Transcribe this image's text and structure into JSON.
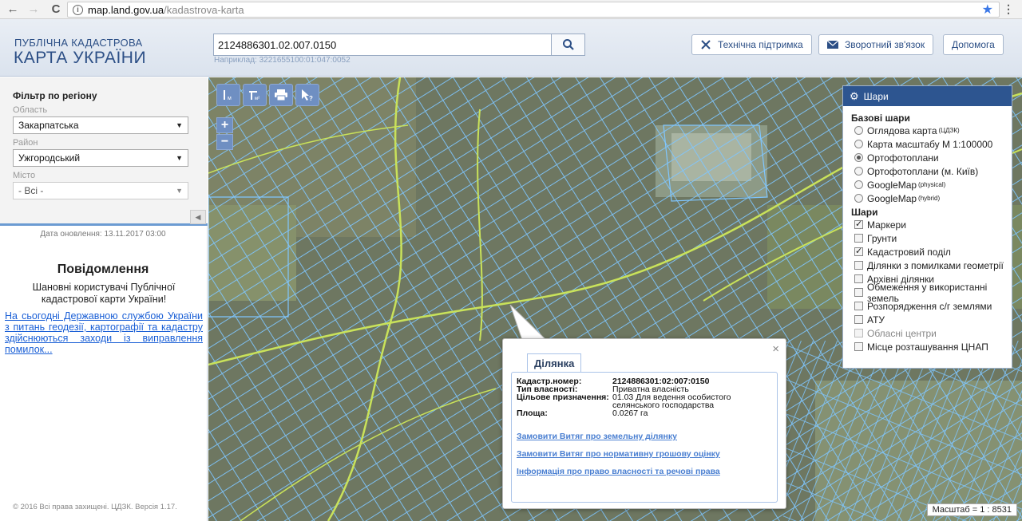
{
  "browser": {
    "back": "←",
    "forward": "→",
    "reload": "C",
    "url_host": "map.land.gov.ua",
    "url_path": "/kadastrova-karta",
    "star": "★",
    "menu": "⋮"
  },
  "header": {
    "logo_top": "ПУБЛІЧНА КАДАСТРОВА",
    "logo_bottom": "КАРТА УКРАЇНИ",
    "search_value": "2124886301.02.007.0150",
    "search_hint": "Наприклад: 3221655100:01:047:0052",
    "buttons": {
      "support": "Технічна підтримка",
      "feedback": "Зворотний зв'язок",
      "help": "Допомога"
    }
  },
  "sidebar": {
    "filter_title": "Фільтр по регіону",
    "region_label": "Область",
    "region_value": "Закарпатська",
    "district_label": "Район",
    "district_value": "Ужгородський",
    "city_label": "Місто",
    "city_value": "- Всі -",
    "update_date": "Дата оновлення: 13.11.2017 03:00",
    "message_title": "Повідомлення",
    "message_body": "Шановні користувачі Публічної кадастрової карти України!",
    "message_link": "На сьогодні Державною службою України з питань геодезії, картографії та кадастру здійснюються заходи із виправлення помилок...",
    "copyright": "© 2016 Всі права захищені. ЦДЗК. Версія 1.17."
  },
  "map": {
    "tools": [
      "I м",
      "I мг",
      "print",
      "info"
    ],
    "zoom_in": "+",
    "zoom_out": "−",
    "scale": "Масштаб = 1 : 8531"
  },
  "layers": {
    "title": "Шари",
    "base_title": "Базові шари",
    "base": [
      {
        "label": "Оглядова карта",
        "sup": "(ЦДЗК)",
        "selected": false
      },
      {
        "label": "Карта масштабу М 1:100000",
        "sup": "",
        "selected": false
      },
      {
        "label": "Ортофотоплани",
        "sup": "",
        "selected": true
      },
      {
        "label": "Ортофотоплани (м. Київ)",
        "sup": "",
        "selected": false
      },
      {
        "label": "GoogleMap",
        "sup": "(physical)",
        "selected": false
      },
      {
        "label": "GoogleMap",
        "sup": "(hybrid)",
        "selected": false
      }
    ],
    "overlay_title": "Шари",
    "overlays": [
      {
        "label": "Маркери",
        "checked": true,
        "disabled": false
      },
      {
        "label": "Грунти",
        "checked": false,
        "disabled": false
      },
      {
        "label": "Кадастровий поділ",
        "checked": true,
        "disabled": false
      },
      {
        "label": "Ділянки з помилками геометрії",
        "checked": false,
        "disabled": false
      },
      {
        "label": "Архівні ділянки",
        "checked": false,
        "disabled": false
      },
      {
        "label": "Обмеження у використанні земель",
        "checked": false,
        "disabled": false
      },
      {
        "label": "Розпорядження с/г землями",
        "checked": false,
        "disabled": false
      },
      {
        "label": "АТУ",
        "checked": false,
        "disabled": false
      },
      {
        "label": "Обласні центри",
        "checked": false,
        "disabled": true
      },
      {
        "label": "Місце розташування ЦНАП",
        "checked": false,
        "disabled": false
      }
    ]
  },
  "popup": {
    "close": "×",
    "tab": "Ділянка",
    "rows": [
      {
        "key": "Кадастр.номер:",
        "value": "2124886301:02:007:0150"
      },
      {
        "key": "Тип власності:",
        "value": "Приватна власність"
      },
      {
        "key": "Цільове призначення:",
        "value": "01.03 Для ведення особистого селянського господарства"
      },
      {
        "key": "Площа:",
        "value": "0.0267 га"
      }
    ],
    "links": [
      "Замовити Витяг про земельну ділянку",
      "Замовити Витяг про нормативну грошову оцінку",
      "Інформація про право власності та речові права"
    ]
  },
  "colors": {
    "brand": "#2c4f86",
    "layers_header": "#2d5590",
    "parcel_outline": "#7fc6ff",
    "road": "#c9e25a",
    "link": "#1a5fd6"
  }
}
